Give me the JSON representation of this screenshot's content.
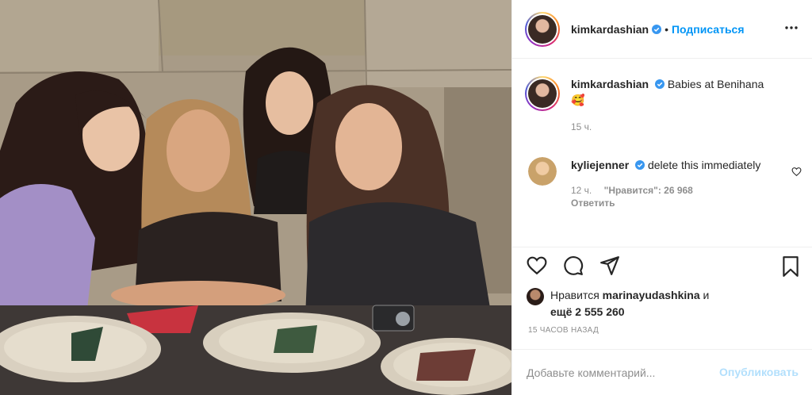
{
  "post": {
    "author": "kimkardashian",
    "follow_label": "Подписаться",
    "dot": "•"
  },
  "caption": {
    "username": "kimkardashian",
    "text": "Babies at Benihana",
    "emoji": "🥰",
    "time": "15 ч."
  },
  "comment": {
    "username": "kyliejenner",
    "text": "delete this immediately",
    "time": "12 ч.",
    "likes": "\"Нравится\": 26 968",
    "reply_label": "Ответить"
  },
  "likes": {
    "prefix": "Нравится",
    "user": "marinayudashkina",
    "conj": "и",
    "rest_prefix": "ещё",
    "count": "2 555 260"
  },
  "timestamp": "15 ЧАСОВ НАЗАД",
  "add_comment": {
    "placeholder": "Добавьте комментарий...",
    "publish_label": "Опубликовать"
  },
  "icons": [
    "more-icon",
    "verified-icon",
    "heart-icon",
    "comment-icon",
    "share-icon",
    "bookmark-icon"
  ],
  "colors": {
    "accent": "#0095f6",
    "publish_disabled": "#b2dffc",
    "verified": "#3897f0"
  }
}
